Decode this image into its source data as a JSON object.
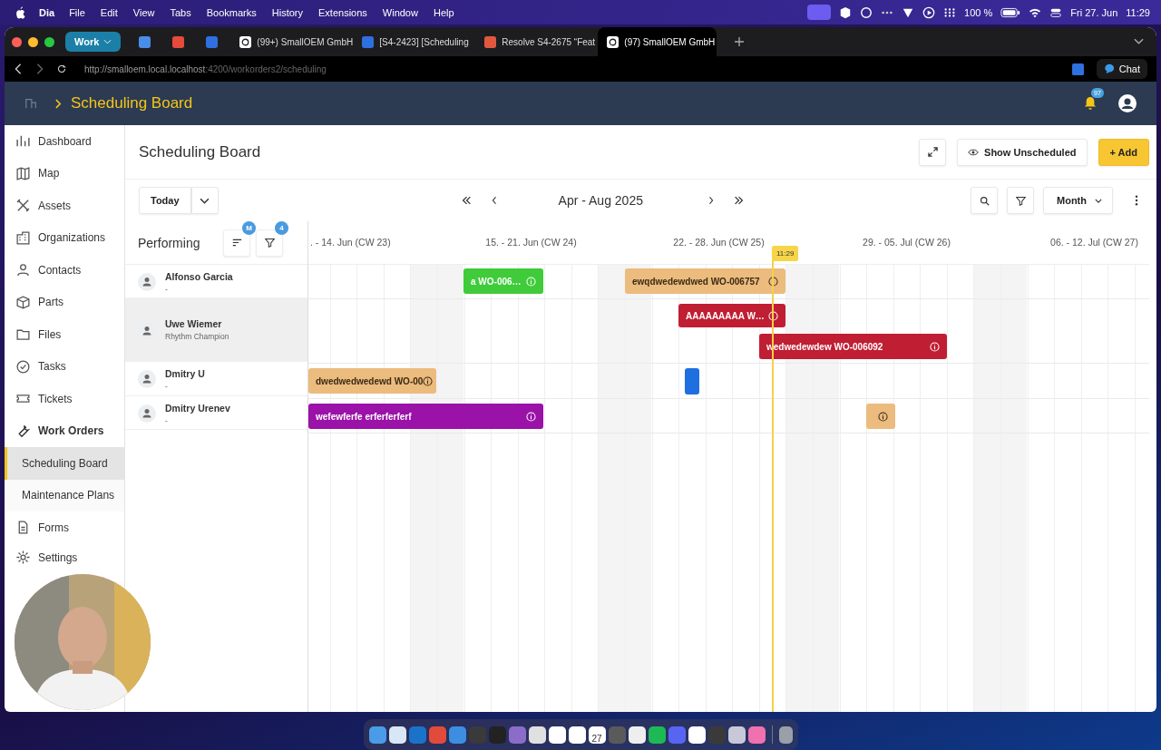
{
  "menubar": {
    "app": "Dia",
    "menus": [
      "File",
      "Edit",
      "View",
      "Tabs",
      "Bookmarks",
      "History",
      "Extensions",
      "Window",
      "Help"
    ],
    "battery": "100 %",
    "date": "Fri 27. Jun",
    "time": "11:29"
  },
  "browser": {
    "profile": "Work",
    "tabs": [
      {
        "kind": "calendar",
        "selected": false
      },
      {
        "kind": "mail",
        "selected": false
      },
      {
        "kind": "tracker",
        "selected": false
      },
      {
        "kind": "app",
        "title": "(99+) SmallOEM GmbH",
        "selected": false
      },
      {
        "kind": "tracker",
        "title": "[S4-2423] [Scheduling",
        "selected": false
      },
      {
        "kind": "fox",
        "title": "Resolve S4-2675 “Feat",
        "selected": false
      },
      {
        "kind": "app",
        "title": "(97) SmallOEM GmbH",
        "selected": true
      }
    ],
    "url_host": "http://smalloem.local.localhost",
    "url_path": ":4200/workorders2/scheduling",
    "chat": "Chat"
  },
  "header": {
    "breadcrumb": "Scheduling Board",
    "notifications": "97"
  },
  "sidebar": {
    "items": [
      {
        "kind": "dashboard",
        "label": "Dashboard",
        "selected": false
      },
      {
        "kind": "map",
        "label": "Map",
        "selected": false
      },
      {
        "kind": "assets",
        "label": "Assets",
        "selected": false
      },
      {
        "kind": "organizations",
        "label": "Organizations",
        "selected": false
      },
      {
        "kind": "contacts",
        "label": "Contacts",
        "selected": false
      },
      {
        "kind": "parts",
        "label": "Parts",
        "selected": false
      },
      {
        "kind": "files",
        "label": "Files",
        "selected": false
      },
      {
        "kind": "tasks",
        "label": "Tasks",
        "selected": false
      },
      {
        "kind": "tickets",
        "label": "Tickets",
        "selected": false
      },
      {
        "kind": "workorders",
        "label": "Work Orders",
        "selected": false,
        "expanded": true,
        "children": [
          {
            "label": "Scheduling Board",
            "selected": true
          },
          {
            "label": "Maintenance Plans",
            "selected": false
          }
        ]
      },
      {
        "kind": "forms",
        "label": "Forms",
        "selected": false
      },
      {
        "kind": "settings",
        "label": "Settings",
        "selected": false
      }
    ]
  },
  "page": {
    "title": "Scheduling Board",
    "show_unscheduled": "Show Unscheduled",
    "add": "+ Add",
    "today": "Today",
    "range": "Apr - Aug 2025",
    "view": "Month"
  },
  "scheduler": {
    "resources_title": "Performing",
    "sort_badge": "M",
    "filter_badge": "4",
    "weeks": [
      ". - 14. Jun (CW 23)",
      "15. - 21. Jun (CW 24)",
      "22. - 28. Jun (CW 25)",
      "29. - 05. Jul (CW 26)",
      "06. - 12. Jul (CW 27)"
    ],
    "now": "11:29",
    "rows": [
      {
        "name": "Alfonso Garcia",
        "subtitle": "-",
        "selected": false,
        "events": [
          {
            "title": "a",
            "code": "WO-006…",
            "color": "#3fcb3a",
            "info": true
          },
          {
            "title": "ewqdwedewdwed",
            "code": "WO-006757",
            "color": "#ecbb7e",
            "info": true
          }
        ]
      },
      {
        "name": "Uwe Wiemer",
        "subtitle": "Rhythm Champion",
        "selected": true,
        "events": [
          {
            "title": "AAAAAAAAA",
            "code": "W…",
            "color": "#c01e33",
            "info": true
          },
          {
            "title": "wedwedewdew",
            "code": "WO-006092",
            "color": "#c01e33",
            "info": true
          }
        ]
      },
      {
        "name": "Dmitry U",
        "subtitle": "-",
        "selected": false,
        "events": [
          {
            "title": "dwedwedwedewd",
            "code": "WO-00",
            "color": "#ecbb7e",
            "info": true
          },
          {
            "color": "#1f6fe0",
            "info": false
          }
        ]
      },
      {
        "name": "Dmitry Urenev",
        "subtitle": "-",
        "selected": false,
        "events": [
          {
            "title": "wefewferfe",
            "code": "erferferferf",
            "color": "#9a12a8",
            "info": true
          },
          {
            "color": "#ecbb7e",
            "info": true
          }
        ]
      }
    ]
  },
  "dock": {
    "calendar_day": "27"
  }
}
